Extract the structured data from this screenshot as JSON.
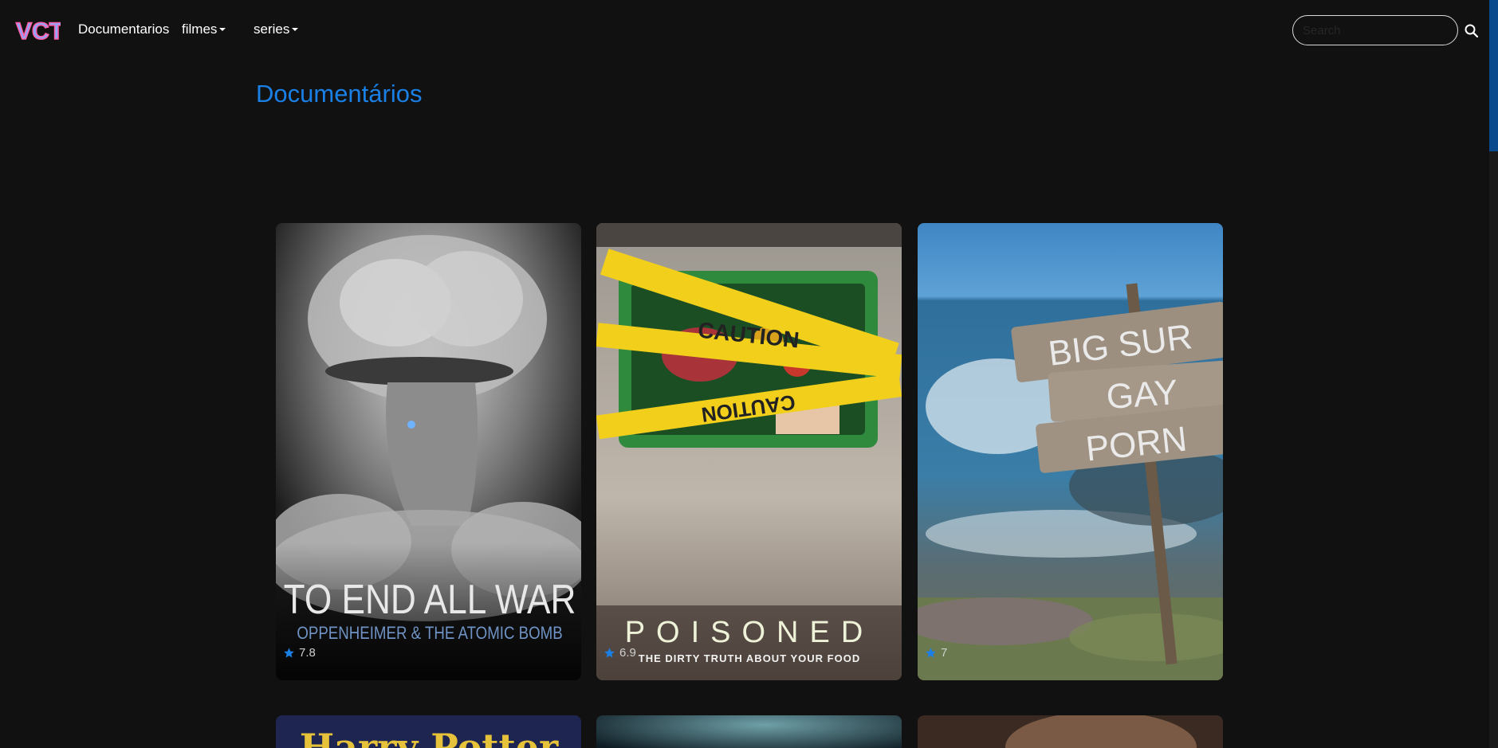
{
  "nav": {
    "logo_alt": "VCT",
    "links": [
      "Documentarios",
      "filmes",
      "series"
    ]
  },
  "search": {
    "placeholder": "Search"
  },
  "page": {
    "title": "Documentários"
  },
  "cards": [
    {
      "title_line1": "TO END ALL WAR",
      "title_line2": "OPPENHEIMER & THE ATOMIC BOMB",
      "rating": "7.8"
    },
    {
      "title_line1": "POISONED",
      "title_line2": "THE DIRTY TRUTH ABOUT YOUR FOOD",
      "rating": "6.9",
      "tape": "CAUTION"
    },
    {
      "sign": [
        "BIG SUR",
        "GAY",
        "PORN"
      ],
      "rating": "7"
    }
  ],
  "partial_cards": [
    {
      "title": "Harry Potter"
    },
    {
      "title": ""
    },
    {
      "title": ""
    }
  ],
  "colors": {
    "accent": "#1a80e6",
    "background": "#111111",
    "star": "#1a80e6"
  }
}
